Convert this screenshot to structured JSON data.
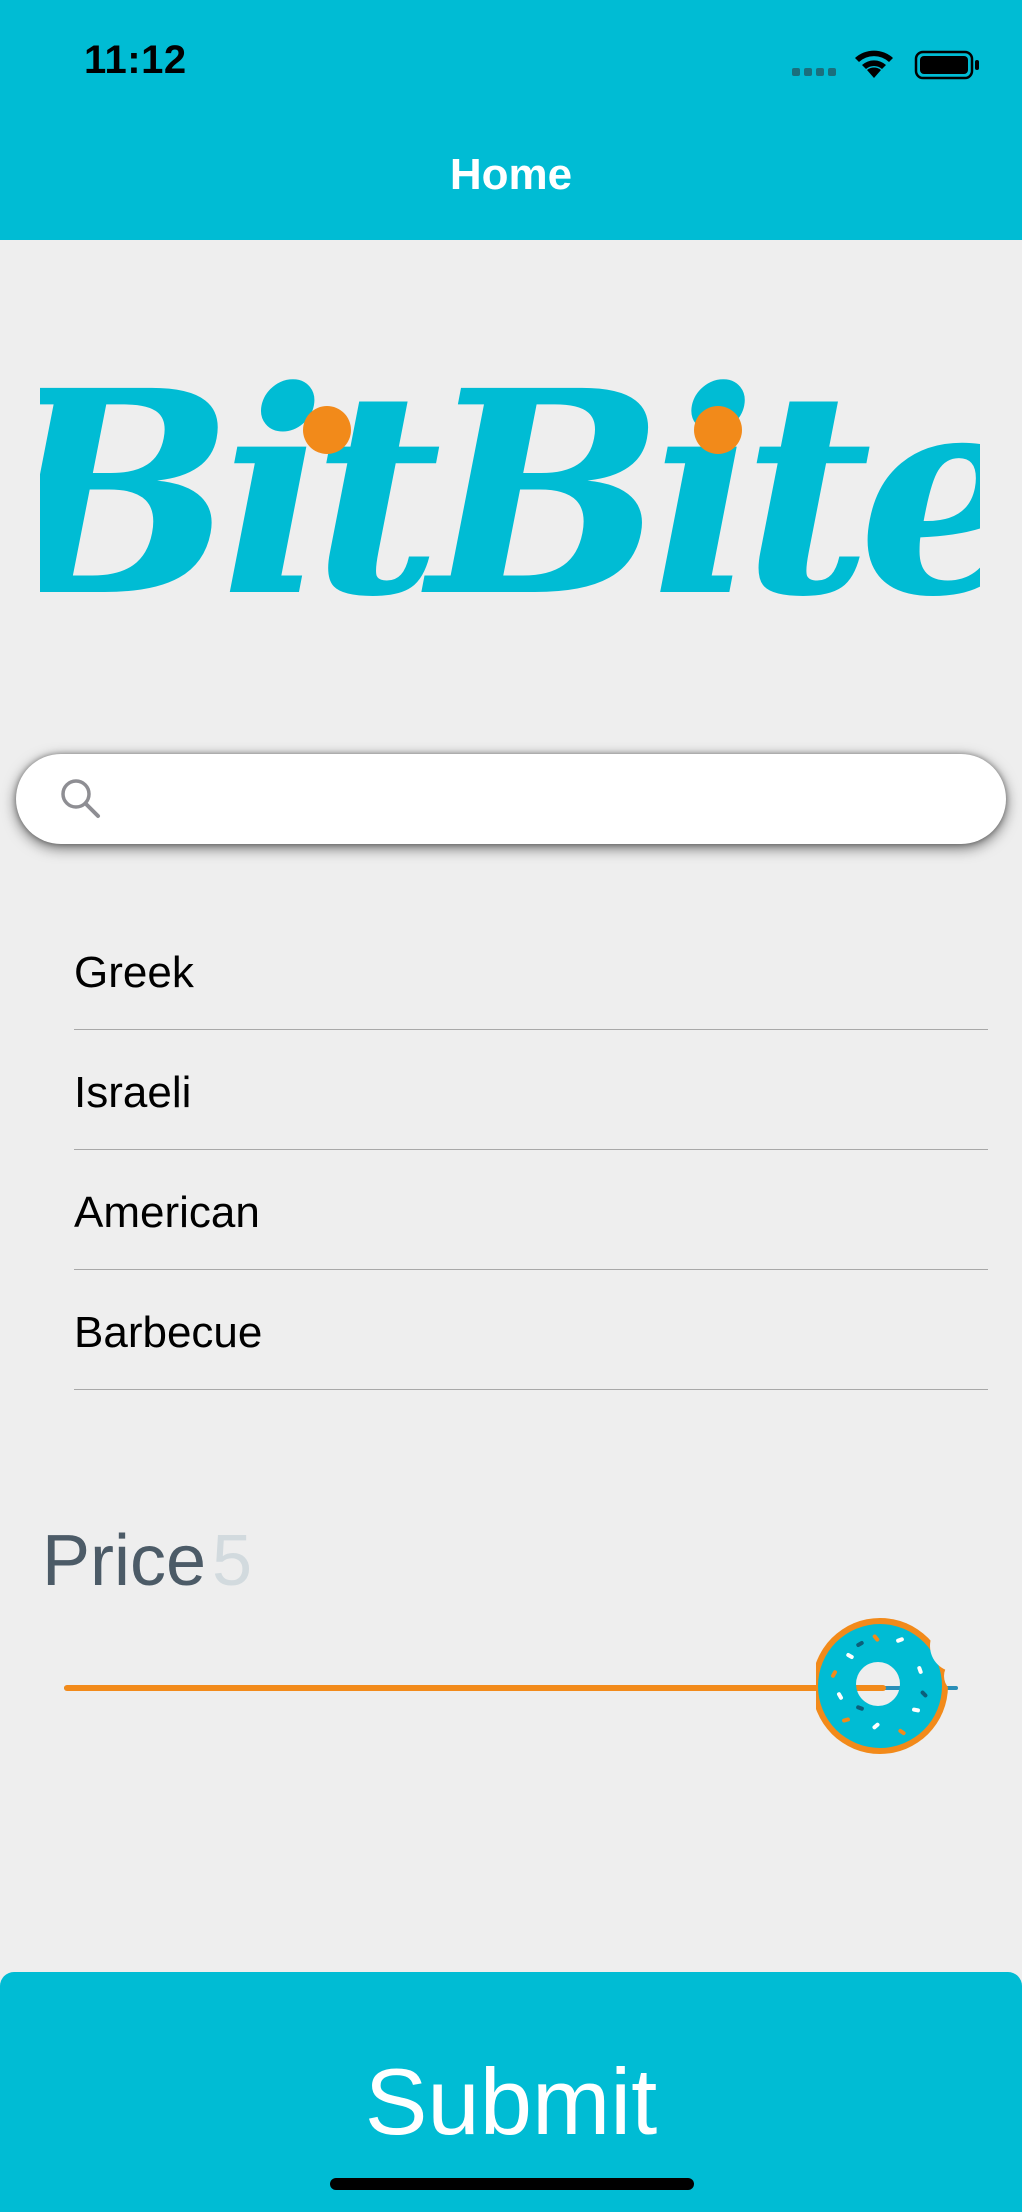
{
  "status_bar": {
    "time": "11:12"
  },
  "nav": {
    "title": "Home"
  },
  "logo": {
    "text": "BitBite",
    "colors": {
      "primary": "#00bcd4",
      "dot": "#f28a1a"
    }
  },
  "search": {
    "value": "",
    "placeholder": ""
  },
  "cuisines": [
    {
      "label": "Greek"
    },
    {
      "label": "Israeli"
    },
    {
      "label": "American"
    },
    {
      "label": "Barbecue"
    }
  ],
  "price": {
    "label": "Price",
    "value": "5",
    "slider_level": 0.92
  },
  "submit_label": "Submit",
  "colors": {
    "accent": "#00bcd4",
    "orange": "#f28a1a",
    "background": "#eeeeee"
  }
}
